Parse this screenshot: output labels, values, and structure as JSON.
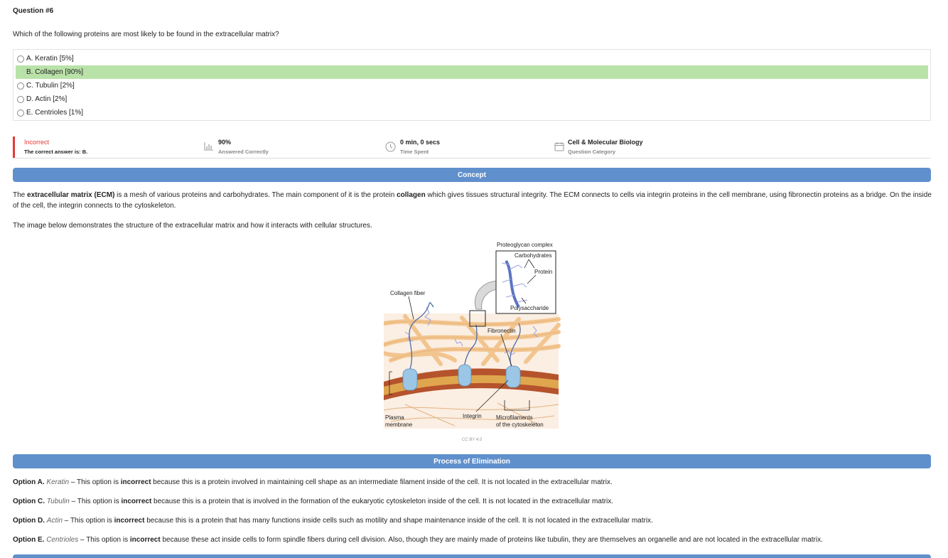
{
  "question": {
    "number_label": "Question #6",
    "text": "Which of the following proteins are most likely to be found in the extracellular matrix?",
    "options": [
      {
        "label": "A. Keratin [5%]",
        "correct": false
      },
      {
        "label": "B. Collagen [90%]",
        "correct": true
      },
      {
        "label": "C. Tubulin [2%]",
        "correct": false
      },
      {
        "label": "D. Actin [2%]",
        "correct": false
      },
      {
        "label": "E. Centrioles [1%]",
        "correct": false
      }
    ]
  },
  "stats": {
    "result": {
      "title": "Incorrect",
      "subtitle": "The correct answer is: B."
    },
    "answered": {
      "value": "90%",
      "label": "Answered Correctly",
      "icon": "bar-chart-icon"
    },
    "time": {
      "value": "0 min, 0 secs",
      "label": "Time Spent",
      "icon": "clock-icon"
    },
    "category": {
      "value": "Cell & Molecular Biology",
      "label": "Question Category",
      "icon": "calendar-icon"
    }
  },
  "colors": {
    "accent": "#6090cc",
    "correct_bg": "#b9e2a8",
    "incorrect": "#e53935"
  },
  "concept": {
    "heading": "Concept",
    "p1": {
      "t1": "The ",
      "b1": "extracellular matrix (ECM)",
      "t2": " is a mesh of various proteins and carbohydrates. The main component of it is the protein ",
      "b2": "collagen",
      "t3": " which gives tissues structural integrity. The ECM connects to cells via integrin proteins in the cell membrane, using fibronectin proteins as a bridge. On the inside of the cell, the integrin connects to the cytoskeleton."
    },
    "p2": "The image below demonstrates the structure of the extracellular matrix and how it interacts with cellular structures.",
    "figure_labels": {
      "proteoglycan": "Proteoglycan complex",
      "carbohydrates": "Carbohydrates",
      "protein": "Protein",
      "polysaccharide": "Polysaccharide",
      "collagen": "Collagen fiber",
      "fibronectin": "Fibronectin",
      "plasma1": "Plasma",
      "plasma2": "membrane",
      "integrin": "Integrin",
      "micro1": "Microfilaments",
      "micro2": "of the cytoskeleton"
    },
    "credit": "CC BY 4.0"
  },
  "elimination": {
    "heading": "Process of Elimination",
    "items": [
      {
        "label": "Option A.",
        "name": "Keratin",
        "pre": " – This option is ",
        "verdict": "incorrect",
        "post": " because this is a protein involved in maintaining cell shape as an intermediate filament inside of the cell. It is not located in the extracellular matrix."
      },
      {
        "label": "Option C.",
        "name": "Tubulin",
        "pre": " – This option is ",
        "verdict": "incorrect",
        "post": " because this is a protein that is involved in the formation of the eukaryotic cytoskeleton inside of the cell. It is not located in the extracellular matrix."
      },
      {
        "label": "Option D.",
        "name": "Actin",
        "pre": " – This option is ",
        "verdict": "incorrect",
        "post": " because this is a protein that has many functions inside cells such as motility and shape maintenance inside of the cell. It is not located in the extracellular matrix."
      },
      {
        "label": "Option E.",
        "name": "Centrioles",
        "pre": " – This option is ",
        "verdict": "incorrect",
        "post": " because these act inside cells to form spindle fibers during cell division. Also, though they are mainly made of proteins like tubulin, they are themselves an organelle and are not located in the extracellular matrix."
      }
    ]
  }
}
